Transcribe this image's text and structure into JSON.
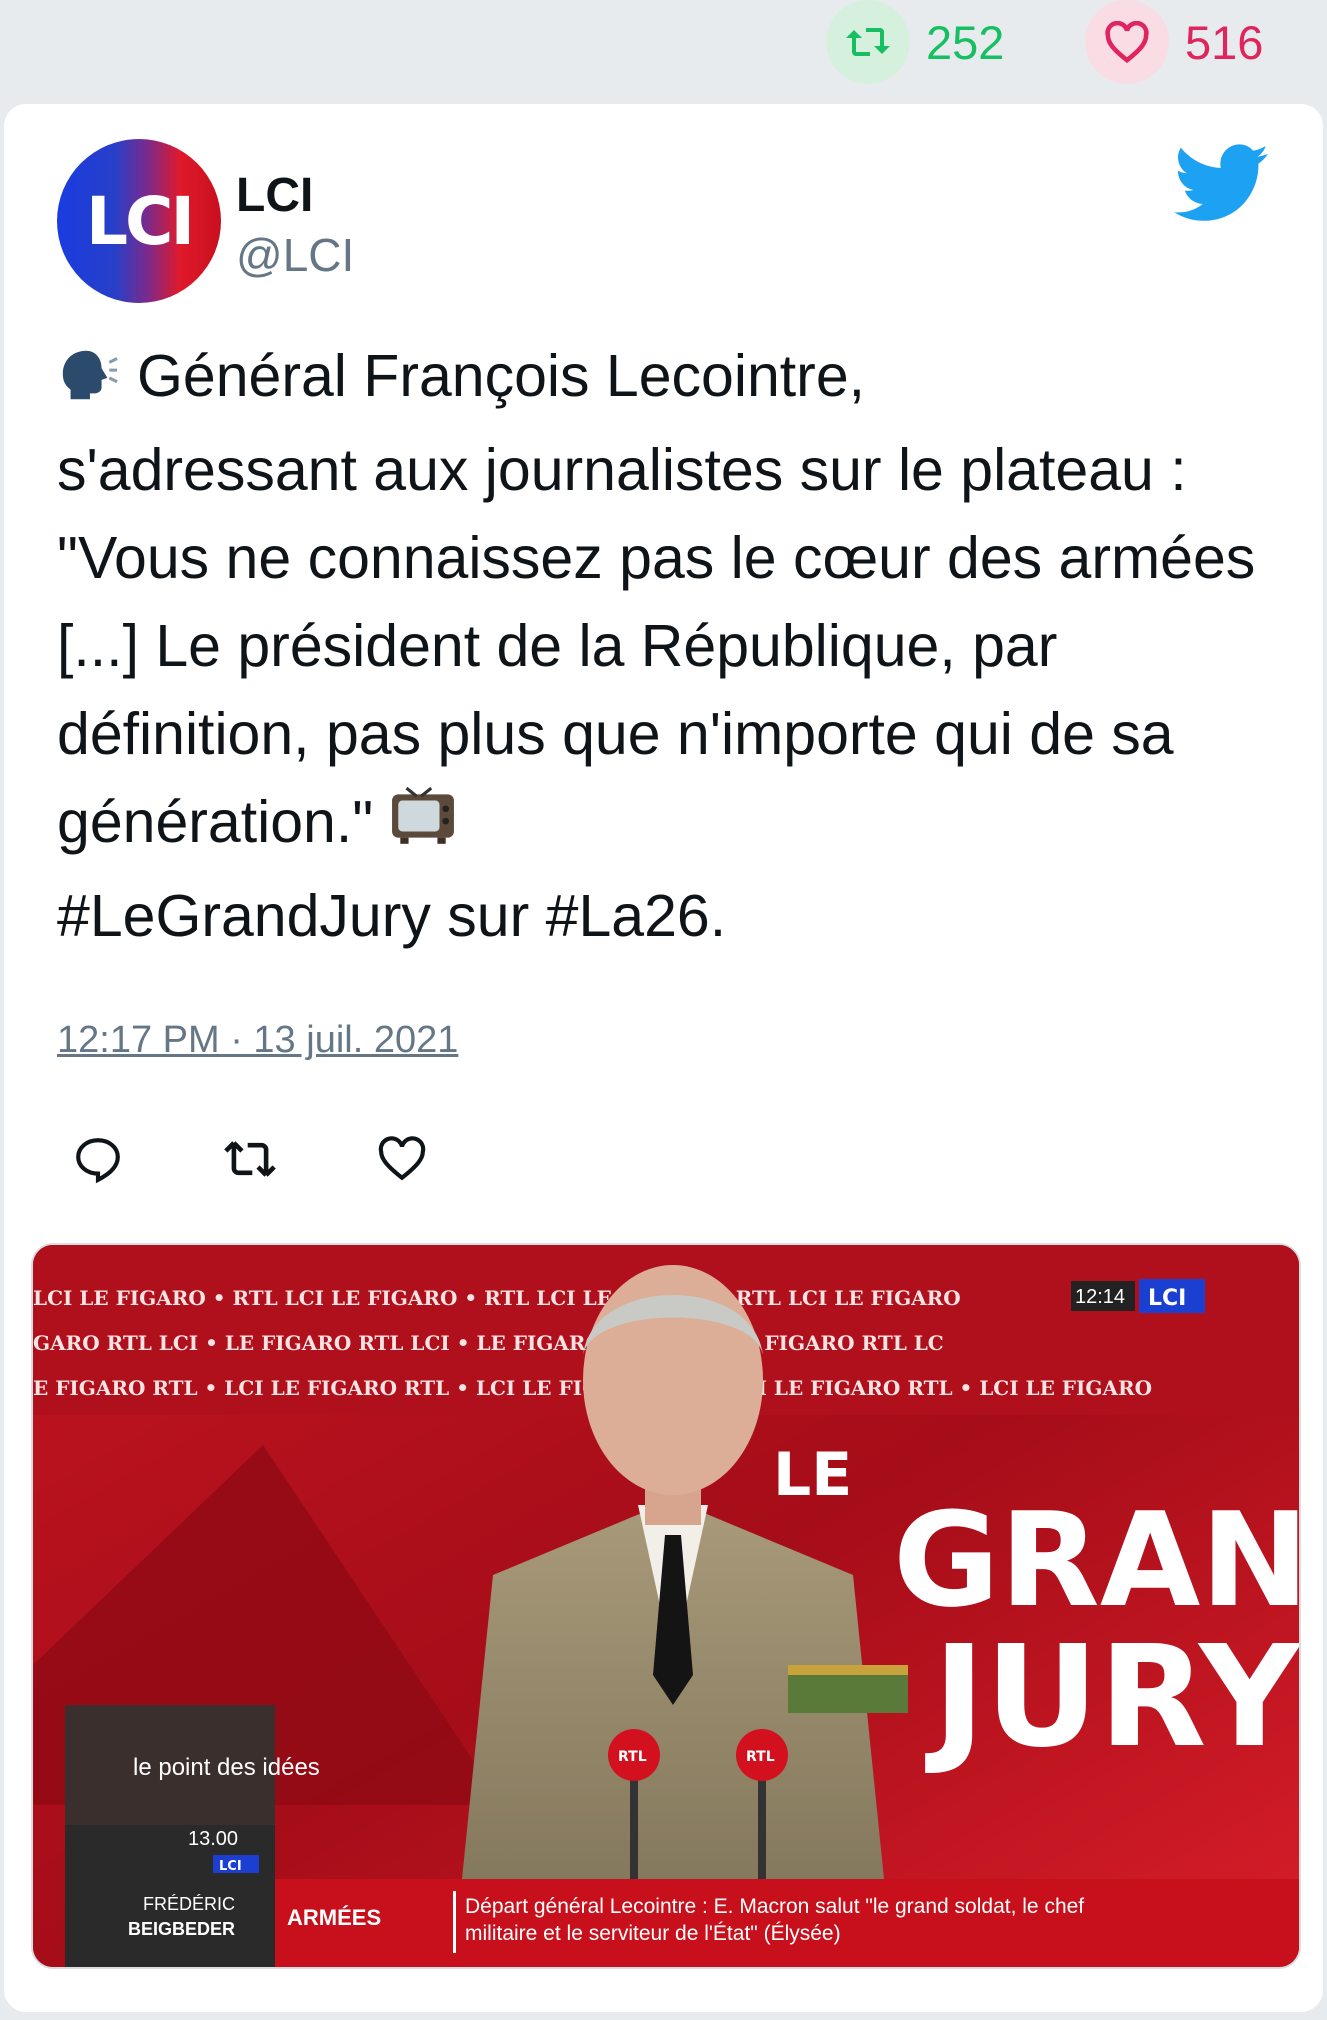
{
  "stats": {
    "retweets": "252",
    "likes": "516",
    "retweet_icon": "retweet-icon",
    "like_icon": "heart-icon",
    "retweet_color": "#17bf63",
    "like_color": "#e0245e"
  },
  "tweet": {
    "avatar_text": "LCI",
    "display_name": "LCI",
    "handle": "@LCI",
    "text_line1": "Général François Lecointre,",
    "text_rest": "s'adressant aux journalistes sur le plateau : \"Vous ne connaissez pas le cœur des armées [...] Le président de la République, par définition, pas plus que n'importe qui de sa génération.\"",
    "hashtag1": "#LeGrandJury",
    "hashtag_join": " sur ",
    "hashtag2": "#La26",
    "text_end": ".",
    "timestamp": "12:17 PM · 13 juil. 2021",
    "brand_color": "#1da1f2"
  },
  "media": {
    "ticker_row1": "LCI  LE FIGARO  •  RTL  LCI  LE FIGARO  •  RTL  LCI  LE FIGARO  •  RTL  LCI  LE FIGARO",
    "ticker_row2": "GARO  RTL  LCI  •  LE FIGARO  RTL  LCI  •  LE FIGARO  RTL  LCI  •  LE FIGARO  RTL  LC",
    "ticker_row3": "E FIGARO RTL  •  LCI LE FIGARO RTL  •  LCI LE FIGARO RTL  •  LCI LE FIGARO RTL  •  LCI LE FIGARO",
    "clock": "12:14",
    "channel": "LCI",
    "show_title_top": "LE",
    "show_title_mid": "GRAND",
    "show_title_bot": "JURY",
    "mic_label": "RTL",
    "promo_show": "le point des idées",
    "promo_time": "13.00",
    "promo_channel": "LCI",
    "promo_guest_first": "FRÉDÉRIC",
    "promo_guest_last": "BEIGBEDER",
    "lower_third_tag": "ARMÉES",
    "lower_third_line1": "Départ général Lecointre : E. Macron salut \"le grand soldat, le chef",
    "lower_third_line2": "militaire et le serviteur de l'État\" (Élysée)"
  }
}
